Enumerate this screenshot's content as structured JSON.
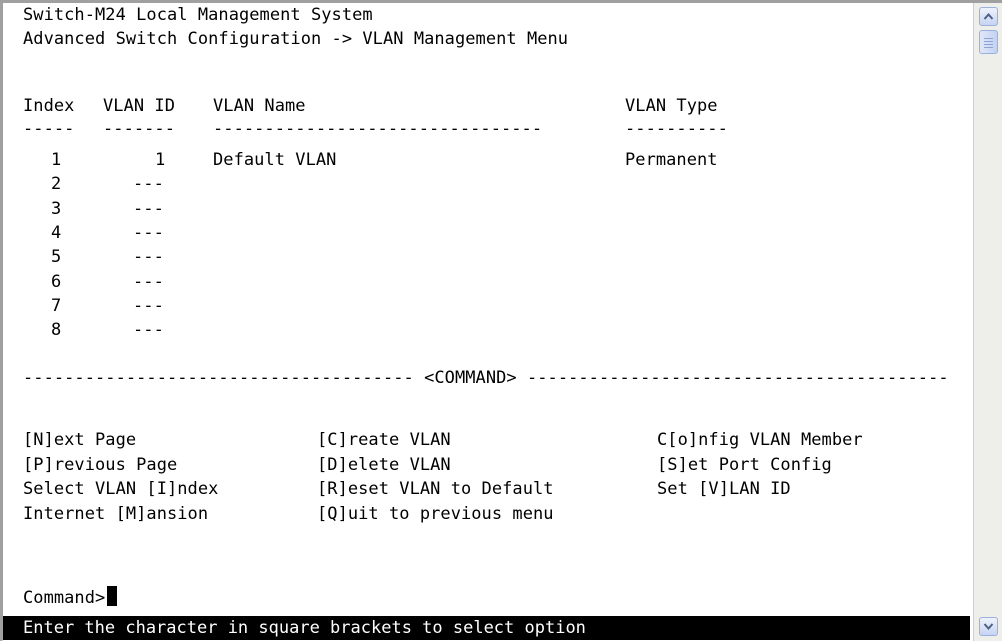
{
  "header": {
    "title": "Switch-M24 Local Management System",
    "breadcrumb": "Advanced Switch Configuration -> VLAN Management Menu"
  },
  "table": {
    "columns": [
      "Index",
      "VLAN ID",
      "VLAN Name",
      "VLAN Type"
    ],
    "separators": [
      "-----",
      "-------",
      "--------------------------------",
      "----------"
    ],
    "rows": [
      {
        "index": "1",
        "vlan_id": "1",
        "vlan_name": "Default VLAN",
        "vlan_type": "Permanent"
      },
      {
        "index": "2",
        "vlan_id": "---",
        "vlan_name": "",
        "vlan_type": ""
      },
      {
        "index": "3",
        "vlan_id": "---",
        "vlan_name": "",
        "vlan_type": ""
      },
      {
        "index": "4",
        "vlan_id": "---",
        "vlan_name": "",
        "vlan_type": ""
      },
      {
        "index": "5",
        "vlan_id": "---",
        "vlan_name": "",
        "vlan_type": ""
      },
      {
        "index": "6",
        "vlan_id": "---",
        "vlan_name": "",
        "vlan_type": ""
      },
      {
        "index": "7",
        "vlan_id": "---",
        "vlan_name": "",
        "vlan_type": ""
      },
      {
        "index": "8",
        "vlan_id": "---",
        "vlan_name": "",
        "vlan_type": ""
      }
    ]
  },
  "command_divider": "<COMMAND>",
  "commands": [
    [
      "[N]ext Page",
      "[C]reate VLAN",
      "C[o]nfig VLAN Member"
    ],
    [
      "[P]revious Page",
      "[D]elete VLAN",
      "[S]et Port Config"
    ],
    [
      "Select VLAN [I]ndex",
      "[R]eset VLAN to Default",
      "Set [V]LAN ID"
    ],
    [
      "Internet [M]ansion",
      "[Q]uit to previous menu",
      ""
    ]
  ],
  "prompt": "Command>",
  "status": "Enter the character in square brackets to select option",
  "scrollbar": {
    "up_icon": "chevron-up-icon",
    "down_icon": "chevron-down-icon",
    "thumb_icon": "grip-icon"
  },
  "colors": {
    "terminal_bg": "#ffffff",
    "terminal_fg": "#000000",
    "status_bg": "#000000",
    "status_fg": "#ffffff",
    "scroll_button": "#c6d4f2"
  }
}
